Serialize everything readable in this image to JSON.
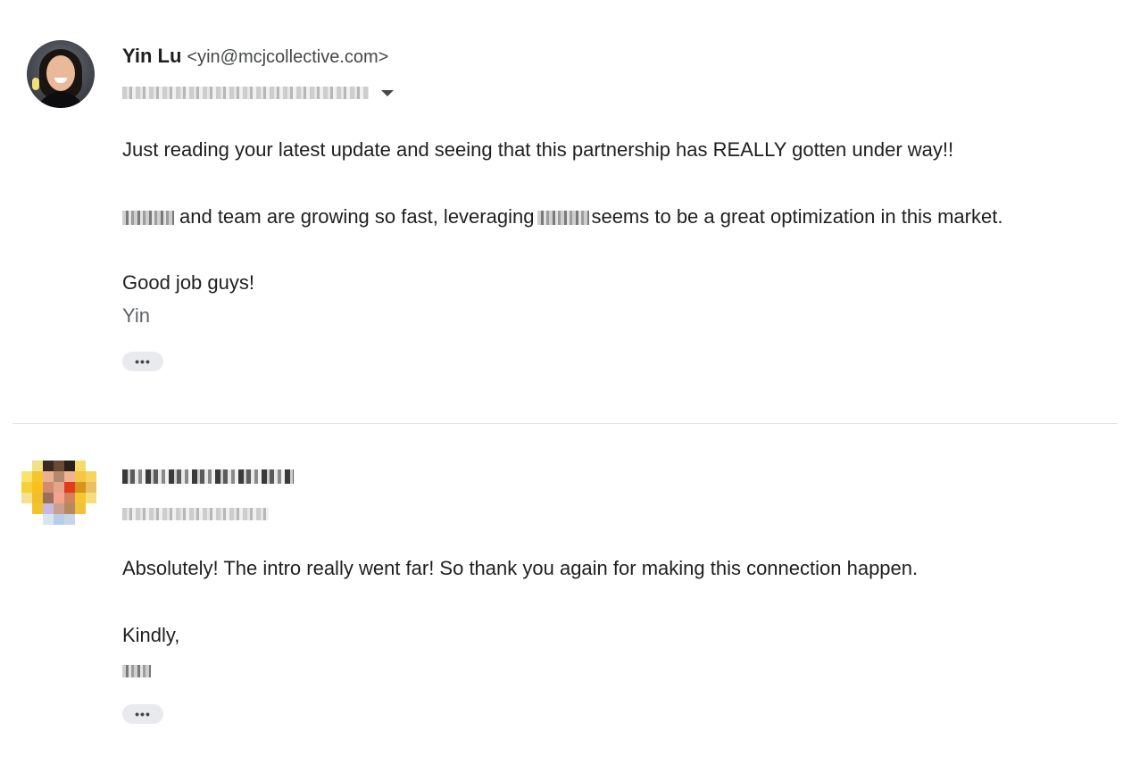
{
  "thread": [
    {
      "sender_name": "Yin Lu",
      "sender_email": "<yin@mcjcollective.com>",
      "body_line_1": "Just reading your latest update and seeing that this partnership has REALLY gotten under way!!",
      "body_line_2_text": "and team are growing so fast, leveraging",
      "body_line_2_tail": "seems to be a great optimization in this market.",
      "body_line_3": "Good job guys!",
      "signature": "Yin",
      "more_label": "•••"
    },
    {
      "body_line_1": "Absolutely! The intro really went far! So thank you again for making this connection happen.",
      "body_line_2": "Kindly,",
      "more_label": "•••"
    }
  ]
}
